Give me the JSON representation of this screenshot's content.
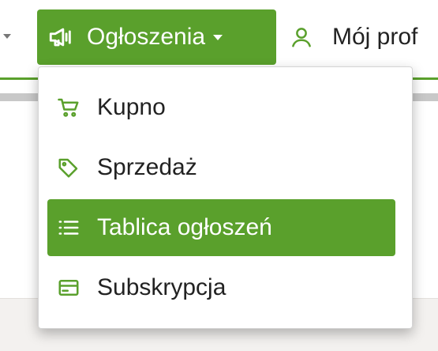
{
  "nav": {
    "active": {
      "label": "Ogłoszenia",
      "icon": "megaphone-icon"
    },
    "profile": {
      "label": "Mój prof",
      "icon": "user-icon"
    }
  },
  "dropdown": {
    "items": [
      {
        "label": "Kupno",
        "icon": "shopping-cart-icon",
        "active": false
      },
      {
        "label": "Sprzedaż",
        "icon": "tag-icon",
        "active": false
      },
      {
        "label": "Tablica ogłoszeń",
        "icon": "list-icon",
        "active": true
      },
      {
        "label": "Subskrypcja",
        "icon": "credit-card-icon",
        "active": false
      }
    ]
  },
  "colors": {
    "accent": "#5aa02c",
    "icon_green": "#5aa02c",
    "text": "#222222"
  }
}
